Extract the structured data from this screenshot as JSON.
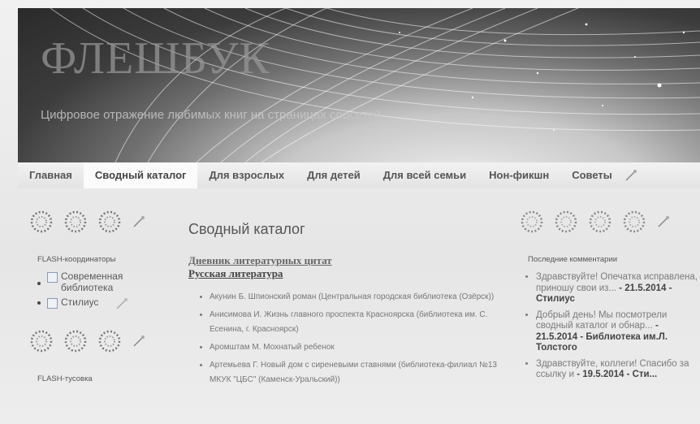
{
  "header": {
    "site_title": "ФЛЕШБУК",
    "tagline": "Цифровое отражение любимых книг на страницах соцсетей"
  },
  "nav": {
    "items": [
      "Главная",
      "Сводный каталог",
      "Для взрослых",
      "Для детей",
      "Для всей семьи",
      "Нон-фикшн",
      "Советы"
    ],
    "active_index": 1
  },
  "left": {
    "widget1_title": "FLASH-координаторы",
    "links": [
      "Современная библиотека",
      "Стилиус"
    ],
    "widget2_title": "FLASH-тусовка"
  },
  "main": {
    "page_title": "Сводный каталог",
    "category_link": "Дневник литературных цитат",
    "subcategory_link": "Русская литература",
    "books": [
      "Акунин Б. Шпионский роман (Центральная городская библиотека (Озёрск))",
      "Анисимова И. Жизнь главного проспекта Красноярска (библиотека им. С. Есенина, г. Красноярск)",
      "Аромштам М. Мохнатый ребенок",
      "Артемьева Г. Новый дом с сиреневыми ставнями (библиотека-филиал №13 МКУК \"ЦБС\" (Каменск-Уральский))"
    ]
  },
  "right": {
    "widget_title": "Последние комментарии",
    "comments": [
      {
        "text": "Здравствуйте! Опечатка исправлена, приношу свои из...",
        "meta": "- 21.5.2014 - Стилиус"
      },
      {
        "text": "Добрый день! Мы посмотрели сводный каталог и обнар...",
        "meta": "- 21.5.2014 - Библиотека им.Л. Толстого"
      },
      {
        "text": "Здравствуйте, коллеги! Спасибо за ссылку и",
        "meta": "- 19.5.2014 - Сти..."
      }
    ]
  },
  "icons": [
    "magic-wand-icon",
    "dotted-circle-icon",
    "facebook-icon"
  ],
  "colors": {
    "banner_dark": "#2a2a2a",
    "page_bg": "#e9e9e9",
    "nav_active_bg": "#fbfbfb",
    "text": "#444444"
  }
}
